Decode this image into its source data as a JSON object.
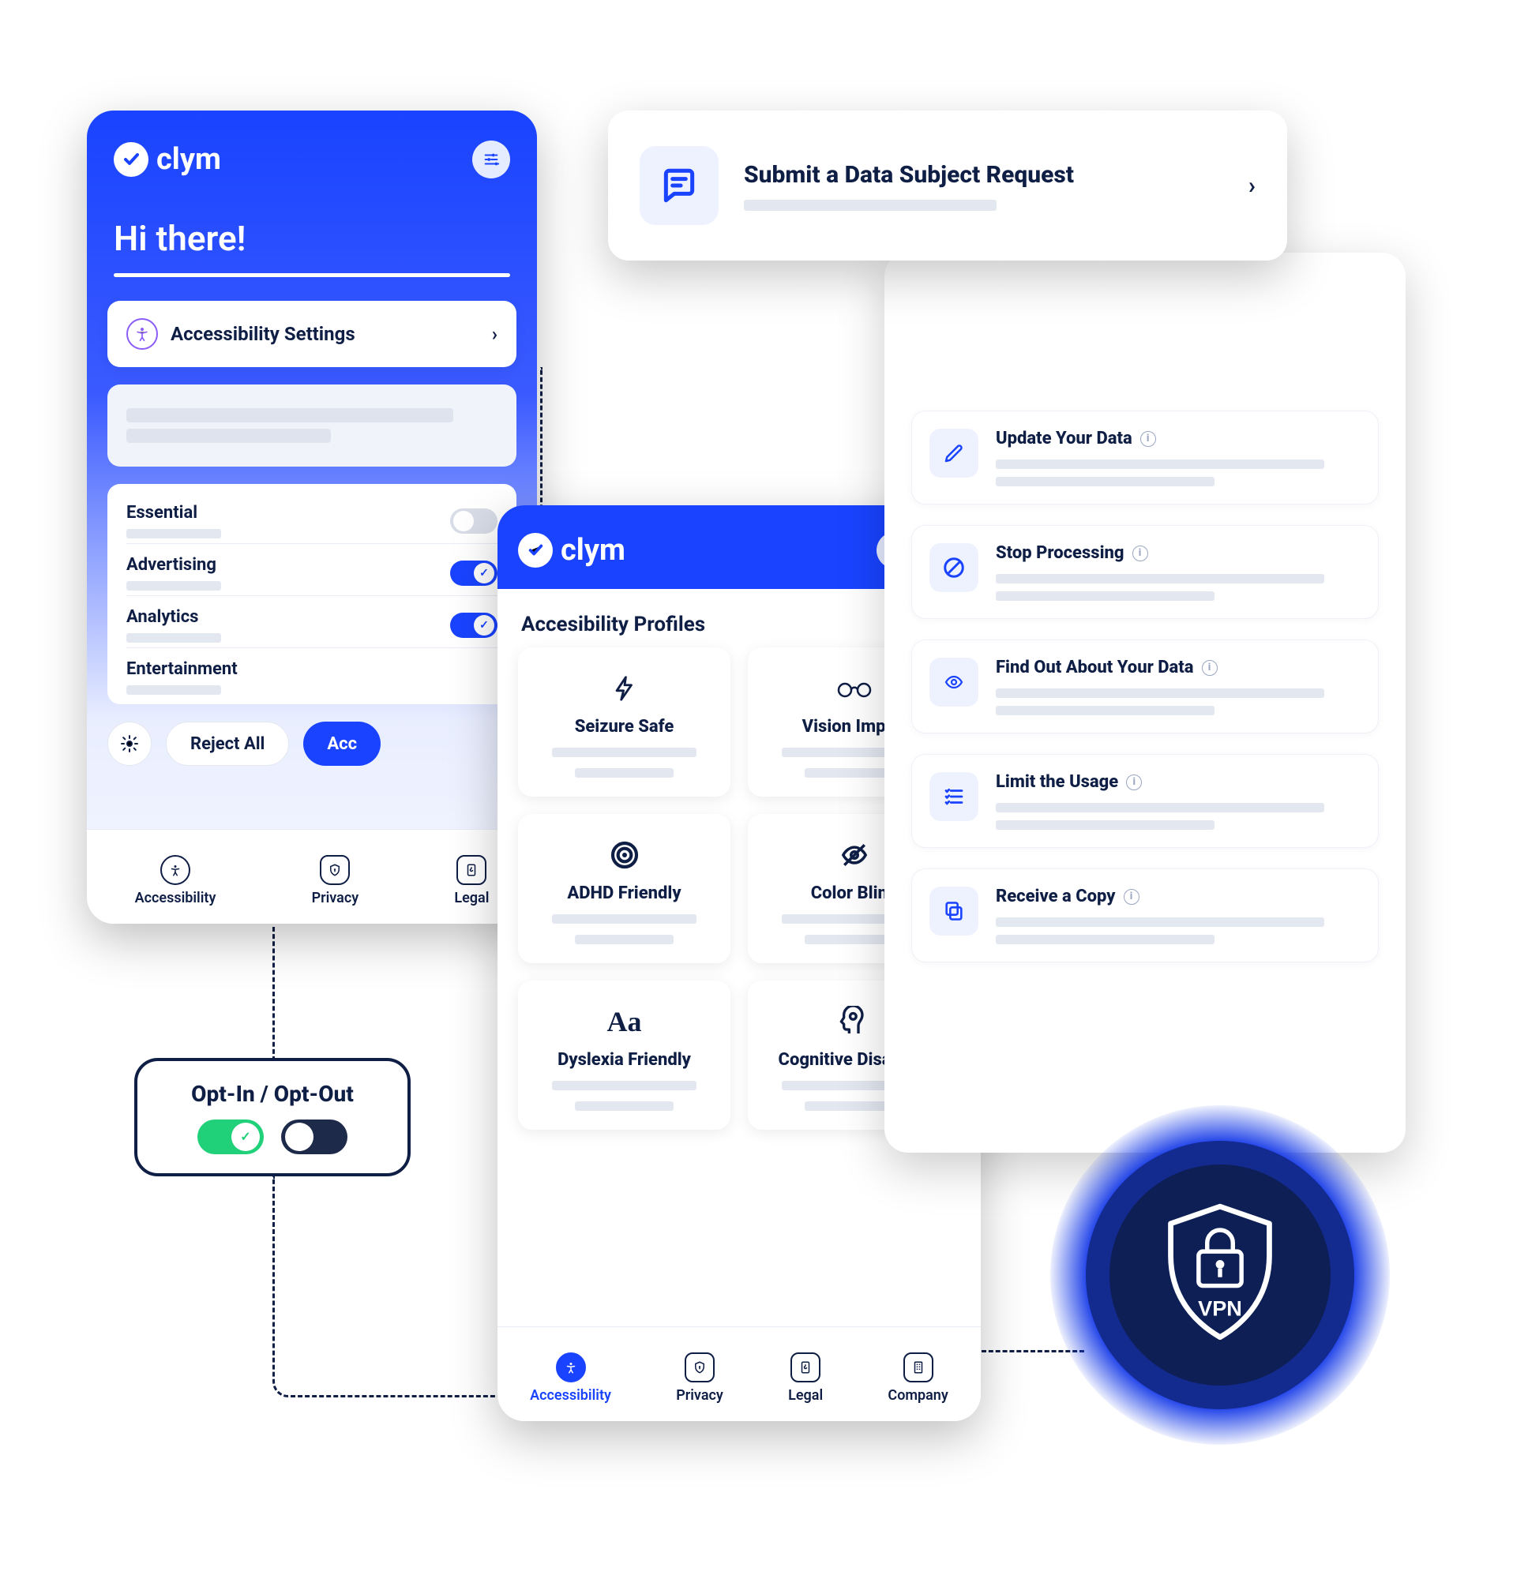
{
  "brand": "clym",
  "phone1": {
    "greeting": "Hi there!",
    "accessibility_settings": "Accessibility Settings",
    "toggles": [
      {
        "label": "Essential",
        "on": false
      },
      {
        "label": "Advertising",
        "on": true
      },
      {
        "label": "Analytics",
        "on": true
      },
      {
        "label": "Entertainment",
        "on": false
      }
    ],
    "reject_all": "Reject All",
    "accept": "Acc",
    "nav": [
      "Accessibility",
      "Privacy",
      "Legal"
    ]
  },
  "phone2": {
    "section_title": "Accesibility Profiles",
    "profiles": [
      "Seizure Safe",
      "Vision Impair",
      "ADHD Friendly",
      "Color Blind",
      "Dyslexia Friendly",
      "Cognitive Disability"
    ],
    "nav": [
      "Accessibility",
      "Privacy",
      "Legal",
      "Company"
    ]
  },
  "dsr": {
    "header_title": "Submit a Data Subject Request",
    "items": [
      "Update Your Data",
      "Stop Processing",
      "Find Out About Your Data",
      "Limit the Usage",
      "Receive a Copy"
    ]
  },
  "optbox": {
    "title": "Opt-In / Opt-Out"
  },
  "vpn": {
    "label": "VPN"
  }
}
